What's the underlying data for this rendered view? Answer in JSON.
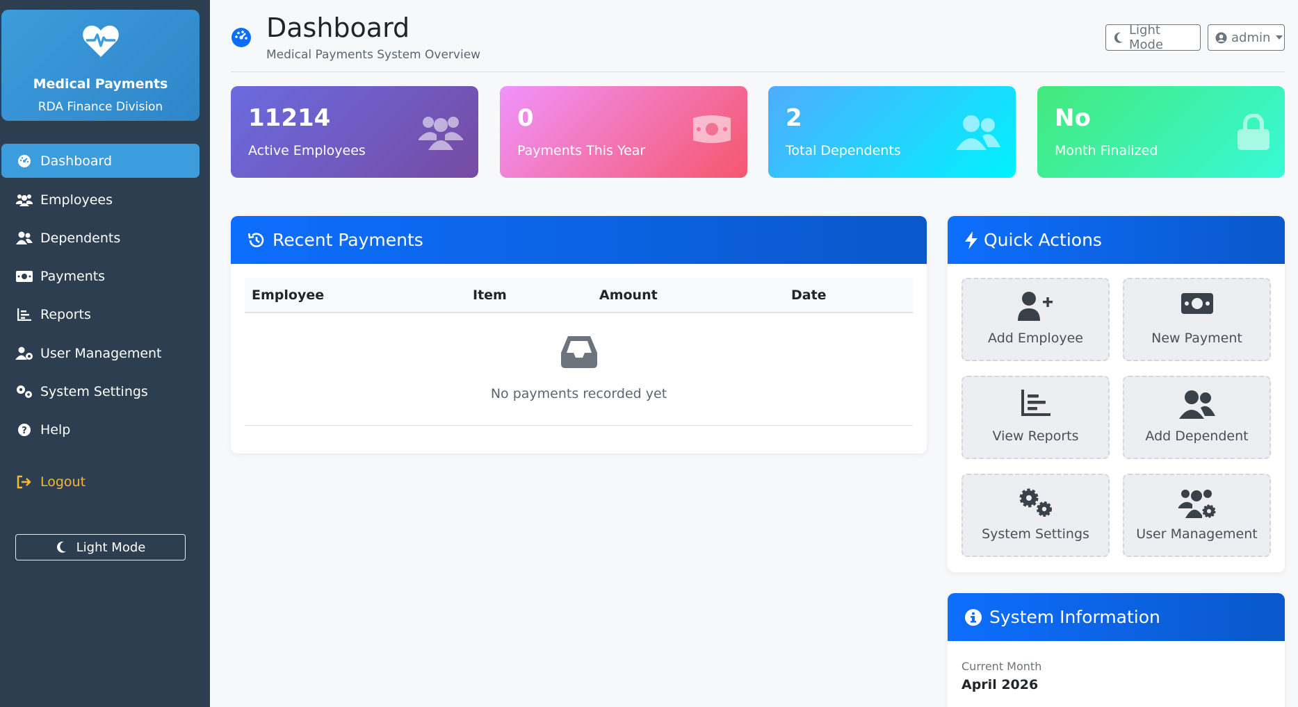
{
  "sidebar": {
    "brand": {
      "title": "Medical Payments",
      "subtitle": "RDA Finance Division",
      "icon": "heart-pulse-icon"
    },
    "items": [
      {
        "label": "Dashboard",
        "icon": "gauge-icon",
        "active": true
      },
      {
        "label": "Employees",
        "icon": "users-icon"
      },
      {
        "label": "Dependents",
        "icon": "user-group-icon"
      },
      {
        "label": "Payments",
        "icon": "money-bill-icon"
      },
      {
        "label": "Reports",
        "icon": "bar-chart-icon"
      },
      {
        "label": "User Management",
        "icon": "user-gear-icon"
      },
      {
        "label": "System Settings",
        "icon": "gears-icon"
      },
      {
        "label": "Help",
        "icon": "question-circle-icon"
      }
    ],
    "logout_label": "Logout",
    "light_mode_label": "Light Mode"
  },
  "header": {
    "title": "Dashboard",
    "subtitle": "Medical Payments System Overview",
    "light_mode_label": "Light Mode",
    "user_label": "admin"
  },
  "stats": [
    {
      "value": "11214",
      "label": "Active Employees",
      "icon": "users-icon"
    },
    {
      "value": "0",
      "label": "Payments This Year",
      "icon": "money-bill-icon"
    },
    {
      "value": "2",
      "label": "Total Dependents",
      "icon": "user-group-icon"
    },
    {
      "value": "No",
      "label": "Month Finalized",
      "icon": "lock-icon"
    }
  ],
  "recent_payments": {
    "title": "Recent Payments",
    "columns": [
      "Employee",
      "Item",
      "Amount",
      "Date"
    ],
    "rows": [],
    "empty_text": "No payments recorded yet"
  },
  "quick_actions": {
    "title": "Quick Actions",
    "items": [
      {
        "label": "Add Employee",
        "icon": "user-plus-icon"
      },
      {
        "label": "New Payment",
        "icon": "money-bill-icon"
      },
      {
        "label": "View Reports",
        "icon": "bar-chart-icon"
      },
      {
        "label": "Add Dependent",
        "icon": "user-group-icon"
      },
      {
        "label": "System Settings",
        "icon": "gears-icon"
      },
      {
        "label": "User Management",
        "icon": "users-gear-icon"
      }
    ]
  },
  "system_info": {
    "title": "System Information",
    "current_month_label": "Current Month",
    "current_month_value": "April 2026"
  },
  "colors": {
    "sidebar_bg": "#2c3e50",
    "accent": "#3d9cdb",
    "panel_header": "#0d6efd",
    "logout": "#f5b82e"
  }
}
